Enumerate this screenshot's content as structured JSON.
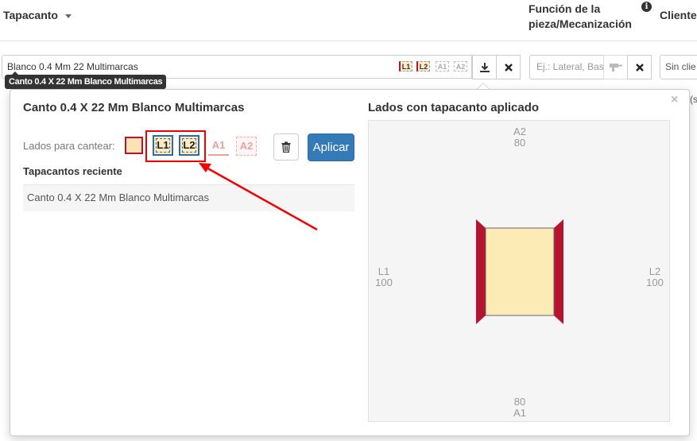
{
  "header": {
    "tapacanto": "Tapacanto",
    "funcion_line1": "Función de la",
    "funcion_line2": "pieza/Mecanización",
    "info_glyph": "i",
    "cliente": "Cliente"
  },
  "row": {
    "main_value": "Blanco 0.4 Mm 22 Multimarcas",
    "mini_sides": [
      "L1",
      "L2",
      "A1",
      "A2"
    ],
    "funcion_placeholder": "Ej.: Lateral, Bas",
    "cliente_value": "Sin clie",
    "background_fragment": "(s"
  },
  "tooltip": "Canto 0.4 X 22 Mm Blanco Multimarcas",
  "popover": {
    "close": "×",
    "title": "Canto 0.4 X 22 Mm Blanco Multimarcas",
    "lados_label": "Lados para cantear:",
    "sides": [
      {
        "label": "L1",
        "selected": true
      },
      {
        "label": "L2",
        "selected": true
      },
      {
        "label": "A1",
        "selected": false
      },
      {
        "label": "A2",
        "selected": false
      }
    ],
    "apply_label": "Aplicar",
    "recent_title": "Tapacantos reciente",
    "recent_items": [
      "Canto 0.4 X 22 Mm Blanco Multimarcas"
    ],
    "right_title": "Lados con tapacanto aplicado",
    "diagram": {
      "top_name": "A2",
      "top_value": "80",
      "bottom_value": "80",
      "bottom_name": "A1",
      "left_name": "L1",
      "left_value": "100",
      "right_name": "L2",
      "right_value": "100"
    }
  },
  "colors": {
    "edge": "#b5132e",
    "piece": "#fdebb5",
    "primary": "#337ab7",
    "annotation": "#e00000"
  },
  "icons": [
    "caret-down-icon",
    "info-icon",
    "download-icon",
    "close-icon",
    "drill-icon",
    "trash-icon"
  ]
}
